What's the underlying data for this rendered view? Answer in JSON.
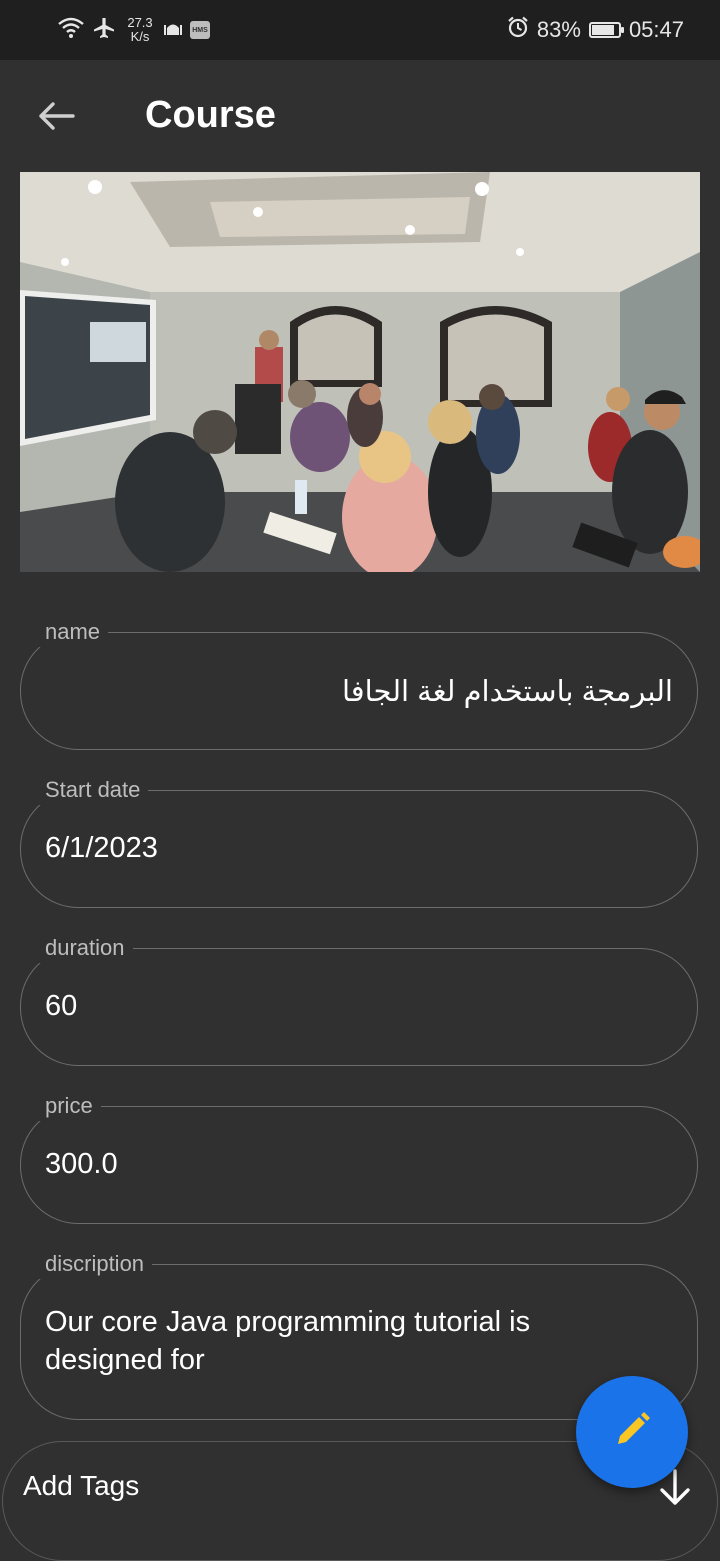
{
  "status_bar": {
    "network_speed": "27.3",
    "network_speed_unit": "K/s",
    "hms_label": "HMS",
    "battery_level": 0.83,
    "battery_percent": "83%",
    "time": "05:47",
    "icons": [
      "wifi-icon",
      "airplane-icon",
      "mosque-icon",
      "hms-icon",
      "alarm-icon",
      "battery-icon"
    ]
  },
  "appbar": {
    "title": "Course",
    "back_icon": "arrow-back-icon"
  },
  "form": {
    "name": {
      "label": "name",
      "value": "البرمجة باستخدام لغة الجافا"
    },
    "start_date": {
      "label": "Start date",
      "value": "6/1/2023"
    },
    "duration": {
      "label": "duration",
      "value": "60"
    },
    "price": {
      "label": "price",
      "value": "300.0"
    },
    "description": {
      "label": "discription",
      "value": "Our core Java programming tutorial is designed for"
    }
  },
  "tags": {
    "label": "Add Tags",
    "icon": "arrow-down-icon"
  },
  "fab": {
    "icon": "pencil-icon"
  },
  "colors": {
    "background": "#303030",
    "status_bar": "#1f1f1f",
    "field_border": "#6c6c6c",
    "label": "#bdbdbd",
    "fab": "#1a73e8",
    "fab_icon": "#f9c623"
  }
}
